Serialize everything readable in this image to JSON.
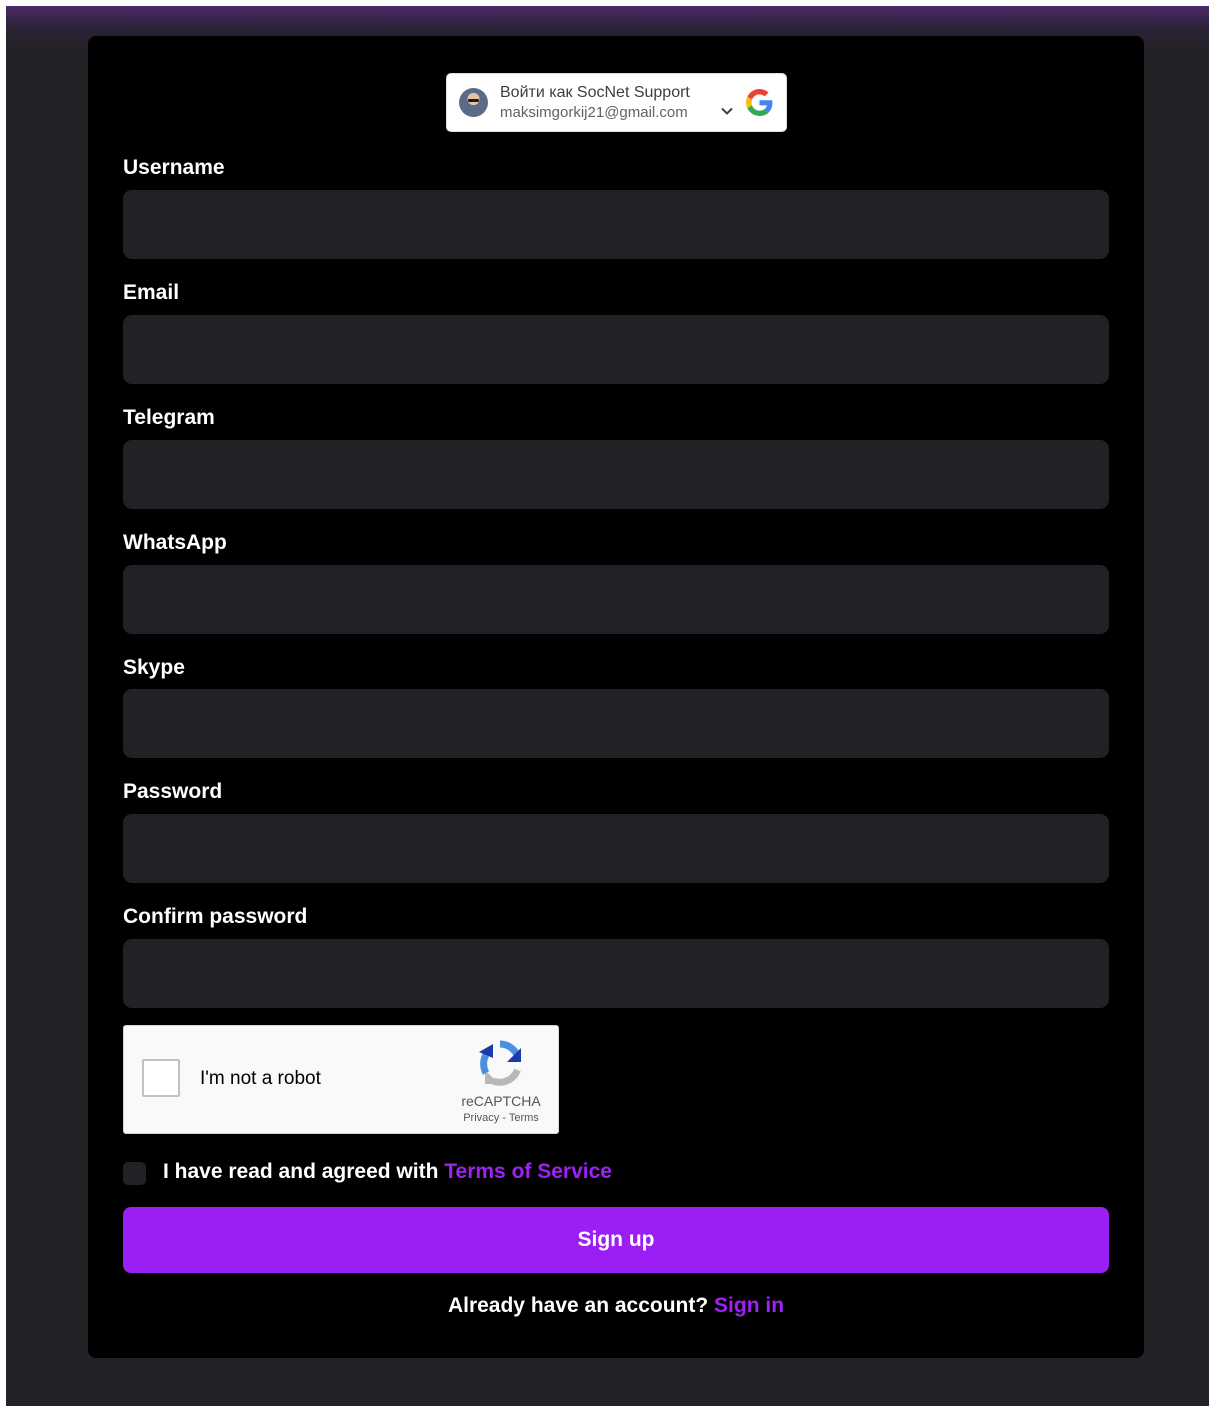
{
  "google_signin": {
    "title": "Войти как SocNet Support",
    "email": "maksimgorkij21@gmail.com",
    "icons": [
      "avatar",
      "chevron-down-icon",
      "google-logo-icon"
    ]
  },
  "form": {
    "fields": [
      {
        "label": "Username",
        "value": ""
      },
      {
        "label": "Email",
        "value": ""
      },
      {
        "label": "Telegram",
        "value": ""
      },
      {
        "label": "WhatsApp",
        "value": ""
      },
      {
        "label": "Skype",
        "value": ""
      },
      {
        "label": "Password",
        "value": ""
      },
      {
        "label": "Confirm password",
        "value": ""
      }
    ]
  },
  "captcha": {
    "label": "I'm not a robot",
    "brand": "reCAPTCHA",
    "privacy": "Privacy",
    "separator": " - ",
    "terms": "Terms"
  },
  "agreement": {
    "text": "I have read and agreed with ",
    "link": "Terms of Service",
    "checked": false
  },
  "submit": {
    "label": "Sign up"
  },
  "signin": {
    "text": "Already have an account? ",
    "link": "Sign in"
  },
  "colors": {
    "accent": "#9b1ff5",
    "card_background": "#000000",
    "page_background": "#232227",
    "input_background": "#222126"
  }
}
